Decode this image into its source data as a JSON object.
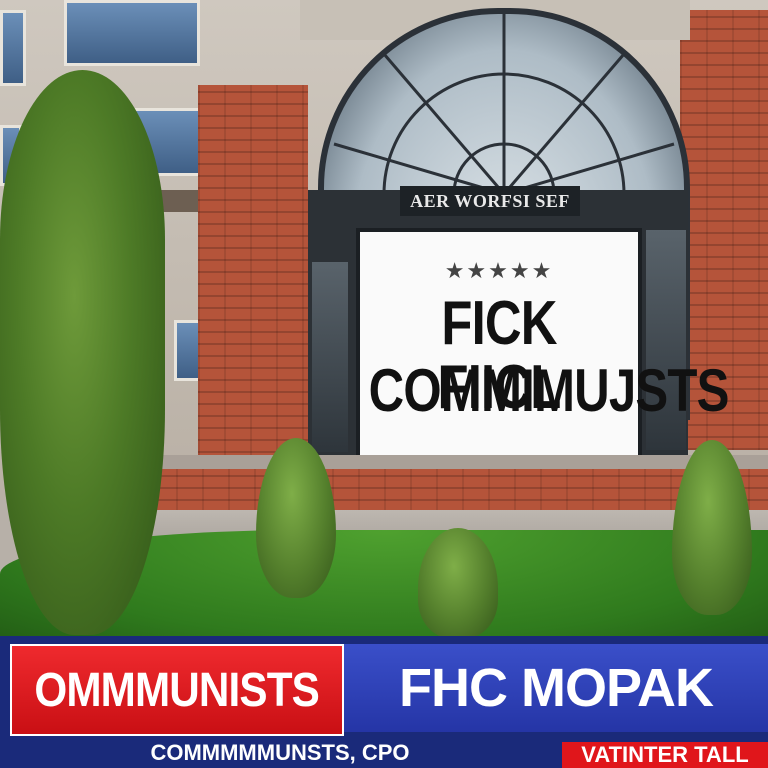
{
  "building": {
    "arch_sign": "AER WORFSI SEF"
  },
  "billboard": {
    "stars": "★★★★★",
    "line1": "FICK FIICL",
    "line2": "COMMIMUJSTS"
  },
  "lower_third": {
    "left_banner": "OMMMUNISTS",
    "right_banner": "FHC MOPAK",
    "bottom_text": "COMMMMMUNSTS, CPO",
    "bottom_tag": "VATINTER TALL"
  },
  "colors": {
    "red": "#e0161b",
    "blue": "#2c3fb3",
    "navy": "#1a2a7a"
  }
}
